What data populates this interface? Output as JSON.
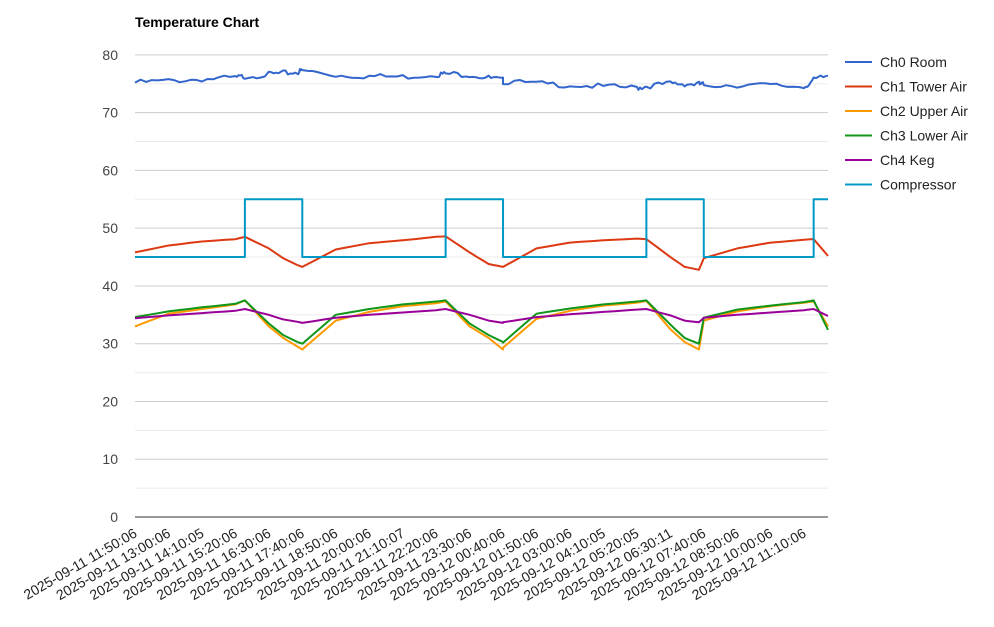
{
  "chart_data": {
    "type": "line",
    "title": "Temperature Chart",
    "xlabel": "",
    "ylabel": "",
    "ylim": [
      0,
      85
    ],
    "yticks": [
      0,
      10,
      20,
      30,
      40,
      50,
      60,
      70,
      80
    ],
    "grid": true,
    "legend_position": "right",
    "x_tick_labels": [
      "2025-09-11 11:50:06",
      "2025-09-11 13:00:06",
      "2025-09-11 14:10:05",
      "2025-09-11 15:20:06",
      "2025-09-11 16:30:06",
      "2025-09-11 17:40:06",
      "2025-09-11 18:50:06",
      "2025-09-11 20:00:06",
      "2025-09-11 21:10:07",
      "2025-09-11 22:20:06",
      "2025-09-11 23:30:06",
      "2025-09-12 00:40:06",
      "2025-09-12 01:50:06",
      "2025-09-12 03:00:06",
      "2025-09-12 04:10:05",
      "2025-09-12 05:20:05",
      "2025-09-12 06:30:11",
      "2025-09-12 07:40:06",
      "2025-09-12 08:50:06",
      "2025-09-12 10:00:06",
      "2025-09-12 11:10:06"
    ],
    "x": [
      "2025-09-11 11:50:06",
      "2025-09-11 13:00:06",
      "2025-09-11 14:10:05",
      "2025-09-11 15:20:06",
      "2025-09-11 15:40",
      "2025-09-11 16:30:06",
      "2025-09-11 17:00",
      "2025-09-11 17:30",
      "2025-09-11 17:40:06",
      "2025-09-11 18:50:06",
      "2025-09-11 20:00:06",
      "2025-09-11 21:10:07",
      "2025-09-11 22:20:06",
      "2025-09-11 22:40",
      "2025-09-11 23:30:06",
      "2025-09-12 00:10",
      "2025-09-12 00:40",
      "2025-09-12 00:40:06",
      "2025-09-12 01:50:06",
      "2025-09-12 03:00:06",
      "2025-09-12 04:10:05",
      "2025-09-12 05:20:05",
      "2025-09-12 05:40",
      "2025-09-12 06:30:11",
      "2025-09-12 07:00",
      "2025-09-12 07:30",
      "2025-09-12 07:40:06",
      "2025-09-12 08:50:06",
      "2025-09-12 10:00:06",
      "2025-09-12 11:10:06",
      "2025-09-12 11:30",
      "2025-09-12 12:00"
    ],
    "series": [
      {
        "name": "Ch0 Room",
        "color": "#3366cc",
        "values": [
          75.2,
          75.5,
          75.8,
          76.0,
          76.3,
          76.6,
          76.8,
          77.0,
          77.3,
          76.5,
          76.3,
          76.2,
          76.6,
          76.7,
          76.6,
          76.0,
          75.6,
          75.4,
          75.0,
          74.8,
          74.5,
          74.3,
          74.6,
          75.0,
          75.0,
          74.9,
          74.8,
          74.8,
          74.7,
          74.5,
          75.6,
          76.4
        ]
      },
      {
        "name": "Ch1 Tower Air",
        "color": "#dc3912",
        "values": [
          45.8,
          47.0,
          47.7,
          48.1,
          48.5,
          46.5,
          44.8,
          43.6,
          43.3,
          46.3,
          47.4,
          47.9,
          48.5,
          48.6,
          45.8,
          43.8,
          43.3,
          43.3,
          46.5,
          47.5,
          47.9,
          48.2,
          48.1,
          45.0,
          43.3,
          42.8,
          44.8,
          46.5,
          47.5,
          48.0,
          48.1,
          45.2
        ]
      },
      {
        "name": "Ch2 Upper Air",
        "color": "#ff9900",
        "values": [
          33.0,
          35.2,
          36.0,
          36.8,
          37.5,
          33.0,
          31.0,
          29.5,
          29.0,
          34.0,
          35.5,
          36.5,
          37.0,
          37.3,
          33.0,
          31.0,
          29.0,
          29.3,
          34.3,
          35.7,
          36.6,
          37.1,
          37.4,
          32.5,
          30.3,
          29.0,
          34.0,
          35.6,
          36.5,
          37.1,
          37.3,
          33.0
        ]
      },
      {
        "name": "Ch3 Lower Air",
        "color": "#109618",
        "values": [
          34.6,
          35.6,
          36.3,
          36.9,
          37.5,
          33.5,
          31.5,
          30.3,
          30.0,
          35.0,
          36.0,
          36.8,
          37.3,
          37.5,
          33.5,
          31.5,
          30.3,
          30.2,
          35.2,
          36.1,
          36.8,
          37.3,
          37.5,
          33.3,
          31.0,
          30.0,
          34.5,
          35.9,
          36.6,
          37.2,
          37.5,
          32.4
        ]
      },
      {
        "name": "Ch4 Keg",
        "color": "#990099",
        "values": [
          34.4,
          34.9,
          35.3,
          35.7,
          36.0,
          35.0,
          34.2,
          33.8,
          33.6,
          34.5,
          35.0,
          35.4,
          35.8,
          36.0,
          35.0,
          34.0,
          33.6,
          33.7,
          34.6,
          35.1,
          35.5,
          35.9,
          36.0,
          34.9,
          34.0,
          33.7,
          34.5,
          35.0,
          35.4,
          35.8,
          36.0,
          34.8
        ]
      },
      {
        "name": "Compressor",
        "color": "#0099c6",
        "values": [
          45,
          45,
          45,
          45,
          55,
          55,
          55,
          55,
          45,
          45,
          45,
          45,
          45,
          55,
          55,
          55,
          55,
          45,
          45,
          45,
          45,
          45,
          55,
          55,
          55,
          55,
          45,
          45,
          45,
          45,
          55,
          55
        ]
      }
    ]
  }
}
